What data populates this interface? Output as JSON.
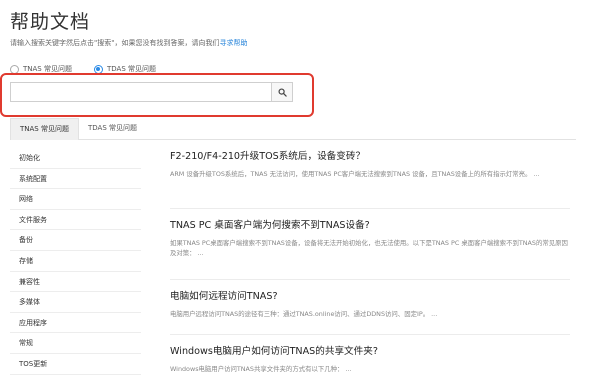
{
  "page": {
    "title": "帮助文档",
    "hint_prefix": "请输入搜索关键字然后点击\"搜索\"，如果您没有找到答案，请向我们",
    "hint_link": "寻求帮助"
  },
  "product_radio": {
    "options": [
      {
        "label": "TNAS 常见问题",
        "checked": false
      },
      {
        "label": "TDAS 常见问题",
        "checked": true
      }
    ]
  },
  "search": {
    "value": "",
    "placeholder": "",
    "button_icon": "search-icon"
  },
  "tabs": [
    {
      "label": "TNAS 常见问题",
      "active": true
    },
    {
      "label": "TDAS 常见问题",
      "active": false
    }
  ],
  "sidebar": {
    "items": [
      {
        "label": "初始化"
      },
      {
        "label": "系统配置"
      },
      {
        "label": "网络"
      },
      {
        "label": "文件服务"
      },
      {
        "label": "备份"
      },
      {
        "label": "存储"
      },
      {
        "label": "兼容性"
      },
      {
        "label": "多媒体"
      },
      {
        "label": "应用程序"
      },
      {
        "label": "常规"
      },
      {
        "label": "TOS更新"
      }
    ]
  },
  "articles": [
    {
      "title": "F2-210/F4-210升级TOS系统后，设备变砖？",
      "summary": "ARM 设备升级TOS系统后，TNAS 无法访问，使用TNAS PC客户端无法搜索到TNAS 设备，且TNAS设备上的所有指示灯常亮。 ..."
    },
    {
      "title": "TNAS PC 桌面客户端为何搜索不到TNAS设备?",
      "summary": "如果TNAS PC桌面客户端搜索不到TNAS设备，设备将无法开始初始化，也无法使用。以下是TNAS PC 桌面客户端搜索不到TNAS的常见原因及对策： ..."
    },
    {
      "title": "电脑如何远程访问TNAS?",
      "summary": "电脑用户远程访问TNAS的途径有三种：通过TNAS.online访问、通过DDNS访问、固定IP。 ..."
    },
    {
      "title": "Windows电脑用户如何访问TNAS的共享文件夹?",
      "summary": "Windows电脑用户访问TNAS共享文件夹的方式有以下几种： ..."
    }
  ],
  "colors": {
    "accent": "#2b8be6",
    "highlight_border": "#e03a2f",
    "link": "#1e7fd8"
  }
}
